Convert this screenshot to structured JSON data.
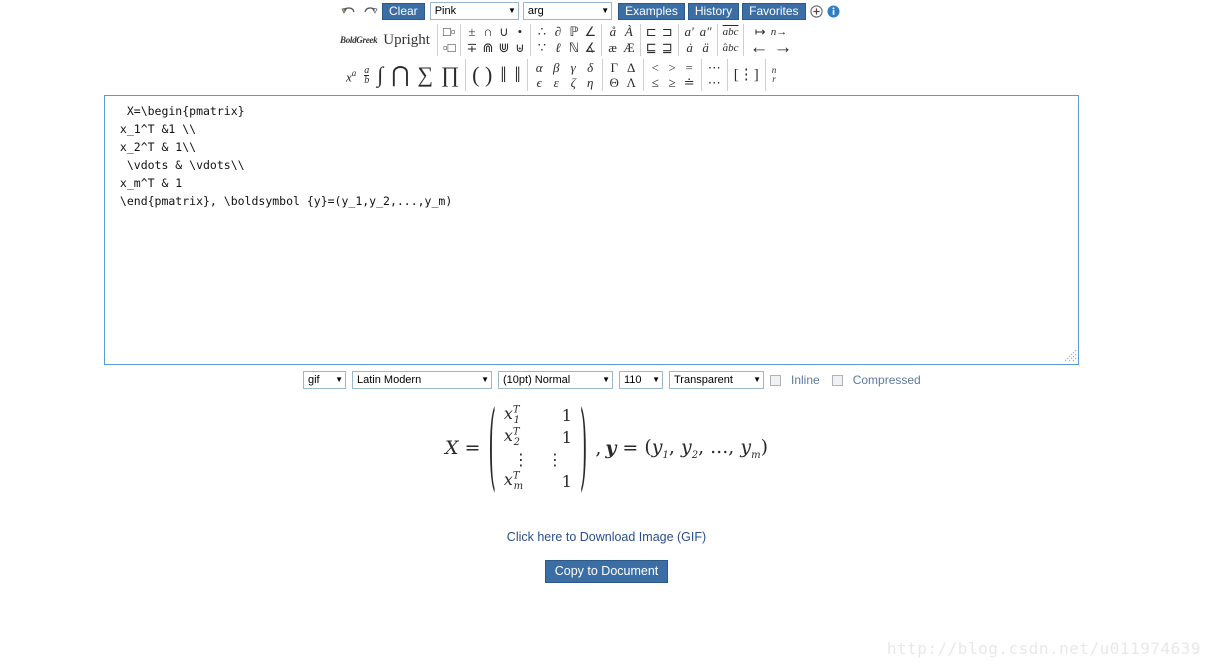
{
  "toolbar": {
    "undo_icon": "undo-arrow-icon",
    "redo_icon": "redo-arrow-icon",
    "clear_label": "Clear",
    "color_select": {
      "value": "Pink"
    },
    "function_select": {
      "value": "arg"
    },
    "examples_label": "Examples",
    "history_label": "History",
    "favorites_label": "Favorites",
    "add_icon": "plus-circle-icon",
    "info_icon": "info-circle-icon"
  },
  "palette": {
    "boldgreek_label": "BoldGreek",
    "upright_label": "Upright",
    "row2_groups": [
      {
        "top": [
          "❑",
          "❑"
        ],
        "bottom": [
          "❑",
          "❑"
        ]
      },
      {
        "top": [
          "±",
          "∩",
          "∪",
          "•"
        ],
        "bottom": [
          "∓",
          "⋒",
          "⊎",
          "⊌"
        ]
      },
      {
        "top": [
          "∴",
          "∂",
          "ℙ",
          "∠"
        ],
        "bottom": [
          "∵",
          "ℓ",
          "ℕ",
          "∡"
        ]
      },
      {
        "top": [
          "å",
          "À"
        ],
        "bottom": [
          "æ",
          "Æ"
        ]
      },
      {
        "top": [
          "⊐",
          "⊑"
        ],
        "bottom": [
          "⊑",
          "⊒"
        ]
      },
      {
        "top": [
          "a′",
          "a″"
        ],
        "bottom": [
          "ȧ",
          "ä"
        ]
      },
      {
        "top": [
          "abc̅"
        ],
        "bottom": [
          "abĉ"
        ]
      },
      {
        "top": [
          "↦",
          "n →"
        ],
        "bottom": [
          "←",
          "→"
        ]
      }
    ],
    "row3_items": [
      "x^a",
      "a/b",
      "∫",
      "⋂",
      "∑",
      "∏",
      "( )",
      "‖",
      "‖"
    ],
    "greek_top": [
      "α",
      "β",
      "γ",
      "δ"
    ],
    "greek_bottom": [
      "ϵ",
      "ε",
      "ζ",
      "η"
    ],
    "greek_caps_top": [
      "Γ",
      "Δ"
    ],
    "greek_caps_bottom": [
      "Θ",
      "Λ"
    ],
    "rel_top": [
      "<",
      ">",
      "="
    ],
    "rel_bottom": [
      "≤",
      "≥",
      "≐"
    ],
    "dots_top": [
      "⋯"
    ],
    "dots_bottom": [
      "⋯"
    ],
    "bracket_matrix": "[⋯]",
    "binomial": "(n r)"
  },
  "editor": {
    "latex": "  X=\\begin{pmatrix}\n x_1^T &1 \\\\\n x_2^T & 1\\\\\n  \\vdots & \\vdots\\\\\n x_m^T & 1\n \\end{pmatrix}, \\boldsymbol {y}=(y_1,y_2,...,y_m)"
  },
  "options": {
    "format": {
      "value": "gif"
    },
    "font": {
      "value": "Latin Modern"
    },
    "size": {
      "value": "(10pt) Normal"
    },
    "zoom": {
      "value": "110"
    },
    "background": {
      "value": "Transparent"
    },
    "inline_label": "Inline",
    "inline_checked": false,
    "compressed_label": "Compressed",
    "compressed_checked": false
  },
  "output": {
    "lhs": "X",
    "equals": "=",
    "matrix_rows": [
      {
        "left": "x",
        "left_sub": "1",
        "left_sup": "T",
        "right": "1"
      },
      {
        "left": "x",
        "left_sub": "2",
        "left_sup": "T",
        "right": "1"
      },
      {
        "left": "⋮",
        "left_sub": "",
        "left_sup": "",
        "right": "⋮"
      },
      {
        "left": "x",
        "left_sub": "m",
        "left_sup": "T",
        "right": "1"
      }
    ],
    "comma": ",",
    "vector_name": "y",
    "vector_equals": "=",
    "vector_value": "(y1, y2, ..., ym)",
    "vector_parts": [
      "y",
      "1",
      "y",
      "2",
      "...",
      "y",
      "m"
    ]
  },
  "actions": {
    "download_link": "Click here to Download Image (GIF)",
    "copy_button": "Copy to Document"
  },
  "watermark": {
    "text": "http://blog.csdn.net/u011974639"
  },
  "colors": {
    "accent_blue": "#3b6ea5",
    "border_blue": "#5b9bd5",
    "link_blue": "#2b4d8c",
    "checkbox_label": "#5c7a9e"
  }
}
